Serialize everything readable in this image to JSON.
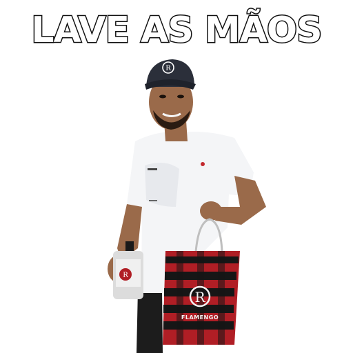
{
  "caption": {
    "text": "LAVE AS MÃOS"
  },
  "bag": {
    "label": "FLAMENGO"
  },
  "colors": {
    "caption_fill": "#ffffff",
    "caption_outline": "#111111",
    "shirt": "#f4f5f7",
    "skin": "#9a6a4a",
    "cap": "#2b2f3a",
    "bag_red": "#b01e25",
    "bag_black": "#161616",
    "bottle_label": "#e2e2e2"
  },
  "icons": [
    "flamengo-crest-icon"
  ]
}
